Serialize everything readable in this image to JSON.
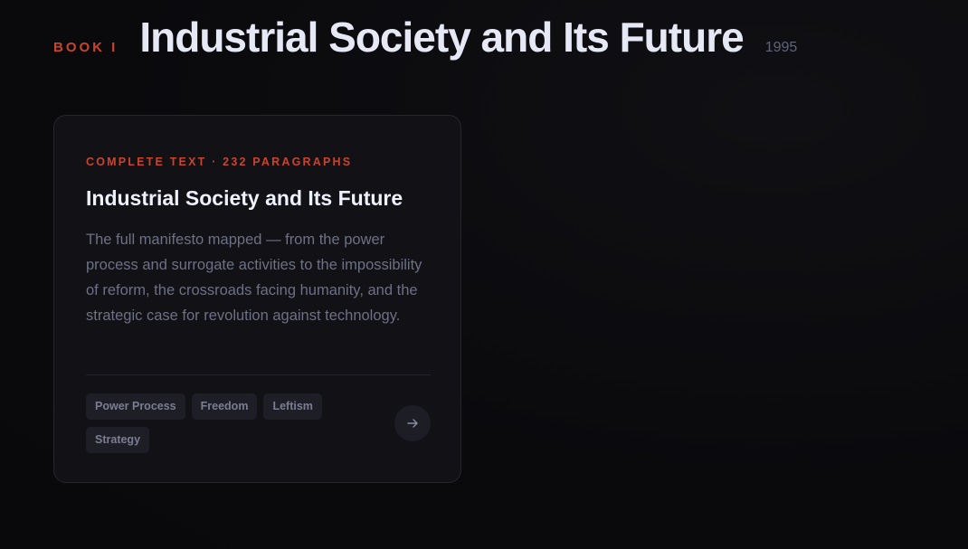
{
  "header": {
    "book_label": "BOOK I",
    "title": "Industrial Society and Its Future",
    "year": "1995"
  },
  "card": {
    "kicker": "COMPLETE TEXT · 232 PARAGRAPHS",
    "title": "Industrial Society and Its Future",
    "description": "The full manifesto mapped — from the power process and surrogate activities to the impossibility of reform, the crossroads facing humanity, and the strategic case for revolution against technology.",
    "tags": [
      "Power Process",
      "Freedom",
      "Leftism",
      "Strategy"
    ],
    "action_icon": "arrow-right-icon"
  },
  "colors": {
    "accent": "#c8452c",
    "background": "#0a0a0d",
    "card_bg": "#111116",
    "title": "#e6e8f5",
    "muted": "#6d7086"
  }
}
